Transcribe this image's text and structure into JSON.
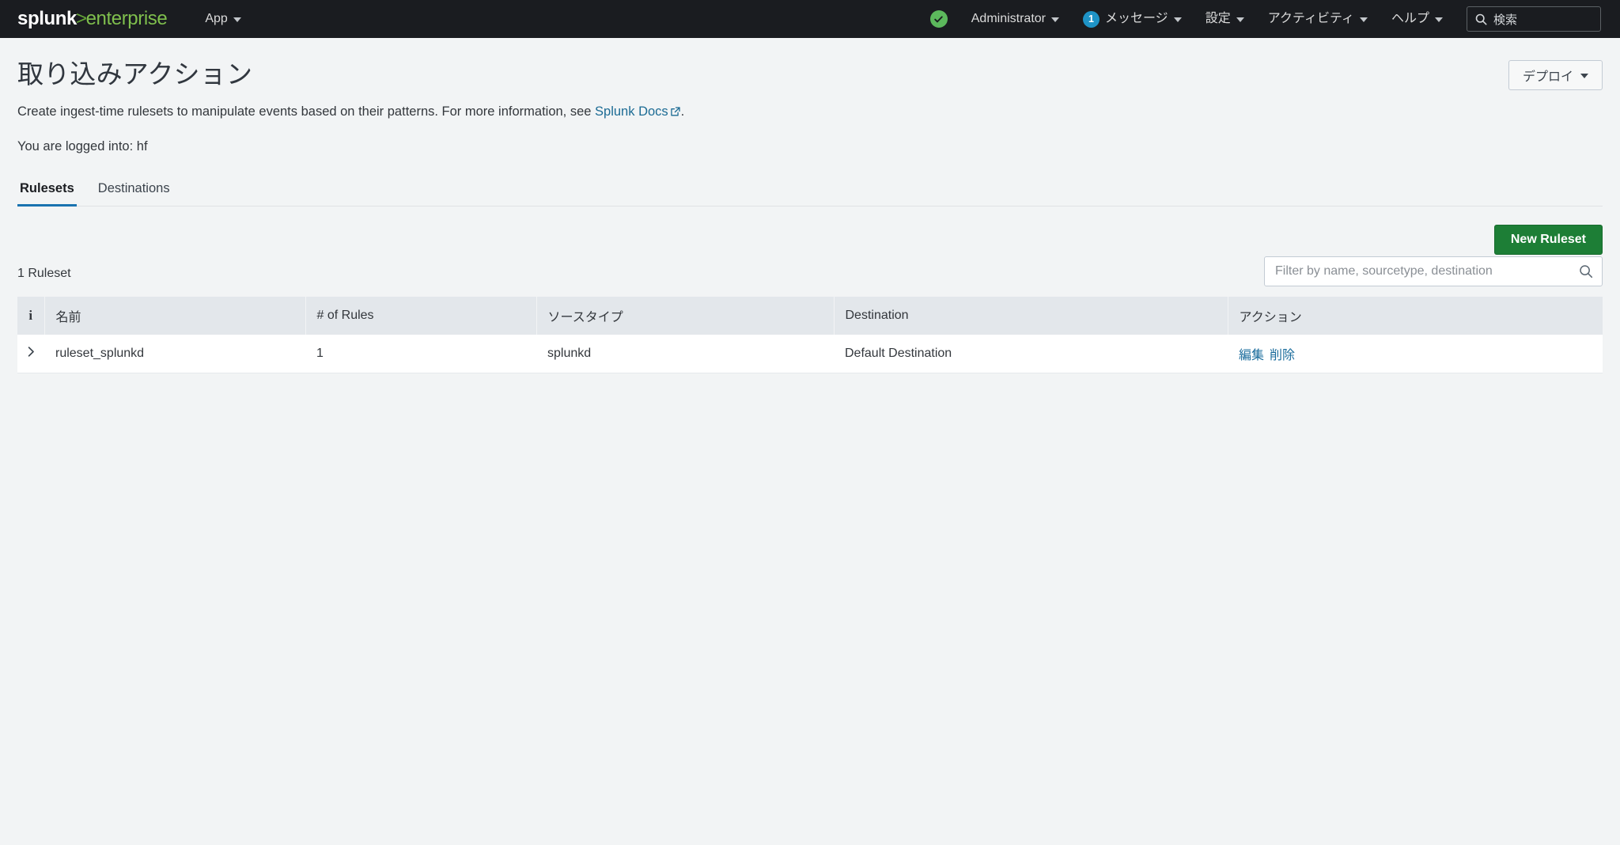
{
  "topbar": {
    "logo": {
      "primary": "splunk",
      "separator": ">",
      "secondary": "enterprise"
    },
    "app_menu": "App",
    "health_icon": "health-check-circle-icon",
    "user_menu": "Administrator",
    "messages": {
      "count": "1",
      "label": "メッセージ"
    },
    "settings_menu": "設定",
    "activity_menu": "アクティビティ",
    "help_menu": "ヘルプ",
    "search": {
      "label": "検索",
      "icon": "search-icon"
    }
  },
  "page": {
    "title": "取り込みアクション",
    "description_before": "Create ingest-time rulesets to manipulate events based on their patterns. For more information, see ",
    "description_link": "Splunk Docs",
    "description_after": ".",
    "external_link_icon": "external-link-icon",
    "logged_into": "You are logged into: hf",
    "deploy_button": "デプロイ"
  },
  "tabs": [
    {
      "label": "Rulesets",
      "active": true
    },
    {
      "label": "Destinations",
      "active": false
    }
  ],
  "controls": {
    "new_ruleset_button": "New Ruleset",
    "count_label": "1 Ruleset",
    "filter_placeholder": "Filter by name, sourcetype, destination",
    "filter_value": "",
    "filter_icon": "search-icon"
  },
  "table": {
    "columns": [
      {
        "key": "info",
        "label": "i"
      },
      {
        "key": "name",
        "label": "名前"
      },
      {
        "key": "rules",
        "label": "# of Rules"
      },
      {
        "key": "sourcetype",
        "label": "ソースタイプ"
      },
      {
        "key": "destination",
        "label": "Destination"
      },
      {
        "key": "actions",
        "label": "アクション"
      }
    ],
    "rows": [
      {
        "expander": "chevron-right-icon",
        "name": "ruleset_splunkd",
        "rules": "1",
        "sourcetype": "splunkd",
        "destination": "Default Destination",
        "actions": [
          "編集",
          "削除"
        ]
      }
    ]
  },
  "colors": {
    "brand_green": "#65a637",
    "accent_blue": "#1a73b0",
    "link_blue": "#1c6b94",
    "primary_button_green": "#1d7e36",
    "topbar_bg": "#1a1c20",
    "page_bg": "#f2f4f5",
    "table_header_bg": "#e3e7eb",
    "badge_blue": "#1e93c6",
    "health_green": "#5cb85c"
  }
}
